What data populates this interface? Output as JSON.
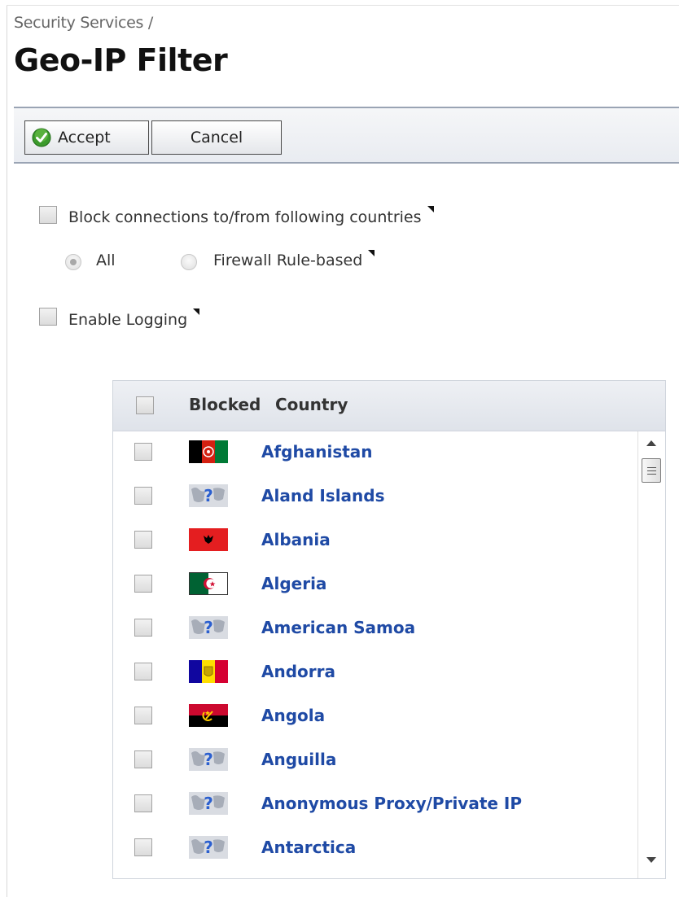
{
  "breadcrumb": "Security Services /",
  "page_title": "Geo-IP Filter",
  "toolbar": {
    "accept_label": "Accept",
    "cancel_label": "Cancel"
  },
  "options": {
    "block_connections": {
      "label": "Block connections to/from following countries",
      "checked": false
    },
    "mode": {
      "all_label": "All",
      "firewall_label": "Firewall Rule-based",
      "selected": "All"
    },
    "enable_logging": {
      "label": "Enable Logging",
      "checked": false
    }
  },
  "country_table": {
    "columns": [
      "Blocked",
      "Country"
    ],
    "rows": [
      {
        "country": "Afghanistan",
        "flag": "afghanistan-flag",
        "blocked": false
      },
      {
        "country": "Aland Islands",
        "flag": "unknown-flag",
        "blocked": false
      },
      {
        "country": "Albania",
        "flag": "albania-flag",
        "blocked": false
      },
      {
        "country": "Algeria",
        "flag": "algeria-flag",
        "blocked": false
      },
      {
        "country": "American Samoa",
        "flag": "unknown-flag",
        "blocked": false
      },
      {
        "country": "Andorra",
        "flag": "andorra-flag",
        "blocked": false
      },
      {
        "country": "Angola",
        "flag": "angola-flag",
        "blocked": false
      },
      {
        "country": "Anguilla",
        "flag": "unknown-flag",
        "blocked": false
      },
      {
        "country": "Anonymous Proxy/Private IP",
        "flag": "unknown-flag",
        "blocked": false
      },
      {
        "country": "Antarctica",
        "flag": "unknown-flag",
        "blocked": false
      }
    ]
  },
  "colors": {
    "link": "#1f4aa5",
    "toolbar_border": "#9aa4b4",
    "header_bg": "#dfe3ea"
  }
}
